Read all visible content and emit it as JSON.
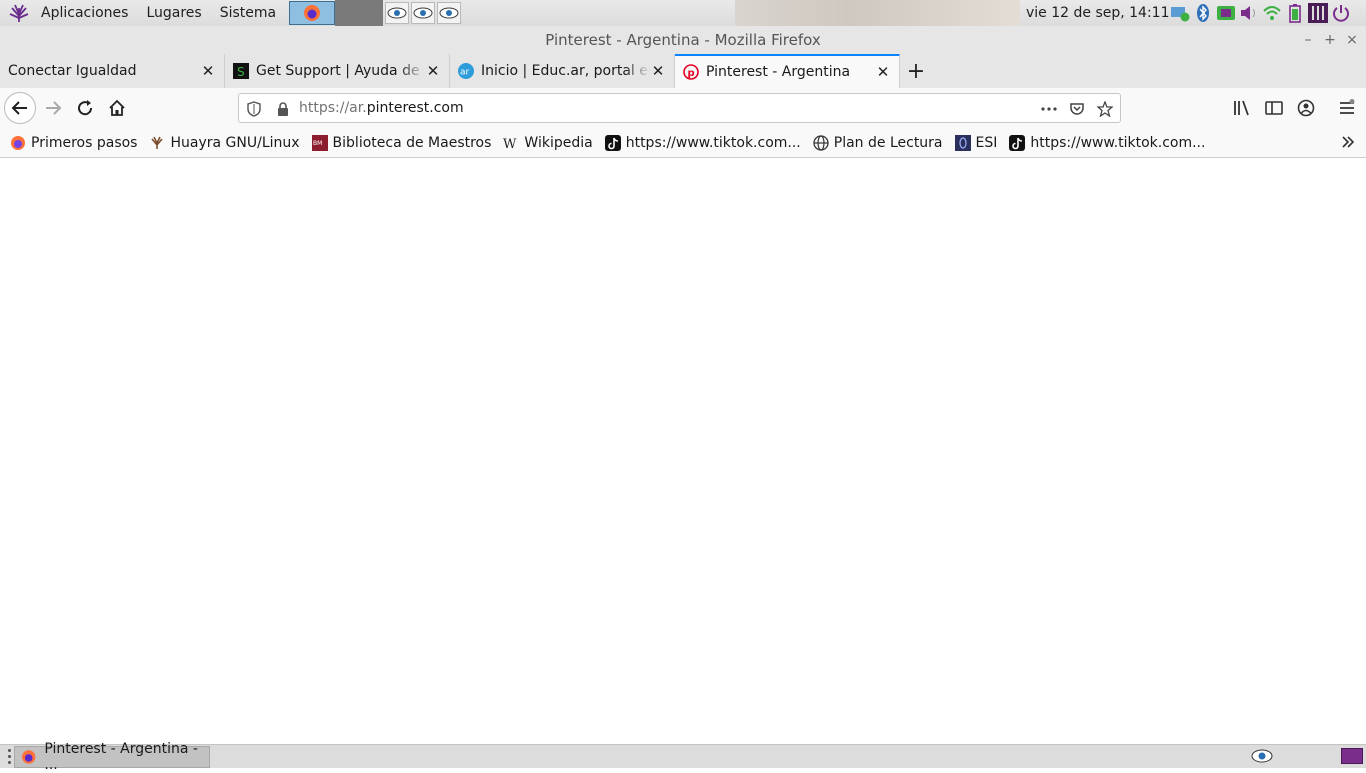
{
  "panel": {
    "menus": [
      "Aplicaciones",
      "Lugares",
      "Sistema"
    ],
    "clock": "vie 12 de sep, 14:11"
  },
  "window": {
    "title": "Pinterest - Argentina - Mozilla Firefox"
  },
  "tabs": [
    {
      "label": "Conectar Igualdad",
      "favicon": "none",
      "active": false
    },
    {
      "label": "Get Support | Ayuda de M",
      "favicon": "green-s-icon",
      "active": false
    },
    {
      "label": "Inicio | Educ.ar, portal edu",
      "favicon": "educar-icon",
      "active": false
    },
    {
      "label": "Pinterest - Argentina",
      "favicon": "pinterest-icon",
      "active": true
    }
  ],
  "navbar": {
    "url_prefix": "https://ar.",
    "url_host": "pinterest.com"
  },
  "bookmarks": [
    {
      "label": "Primeros pasos",
      "icon": "firefox-icon"
    },
    {
      "label": "Huayra GNU/Linux",
      "icon": "huayra-icon"
    },
    {
      "label": "Biblioteca de Maestros",
      "icon": "bnm-icon"
    },
    {
      "label": "Wikipedia",
      "icon": "wikipedia-icon"
    },
    {
      "label": "https://www.tiktok.com...",
      "icon": "tiktok-icon"
    },
    {
      "label": "Plan de Lectura",
      "icon": "globe-icon"
    },
    {
      "label": "ESI",
      "icon": "esi-icon"
    },
    {
      "label": "https://www.tiktok.com...",
      "icon": "tiktok-icon"
    }
  ],
  "taskbar": {
    "window_label": "Pinterest - Argentina - ..."
  },
  "colors": {
    "accent": "#0a84ff",
    "pinterest": "#e60023",
    "workspace": "#7b2d8b"
  }
}
